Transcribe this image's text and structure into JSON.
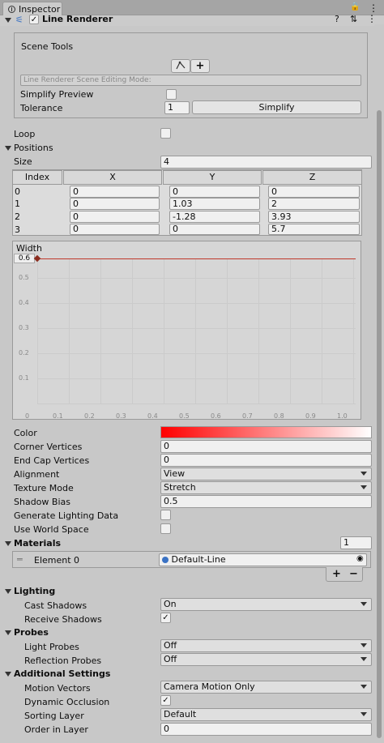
{
  "window": {
    "tab_title": "Inspector"
  },
  "component": {
    "title": "Line Renderer",
    "enabled_check": "✓"
  },
  "scene_tools": {
    "title": "Scene Tools",
    "edit_icon": "curve-edit-icon",
    "add_icon": "+",
    "mode_placeholder": "Line Renderer Scene Editing Mode:",
    "simplify_preview_label": "Simplify Preview",
    "tolerance_label": "Tolerance",
    "tolerance_value": "1",
    "simplify_button": "Simplify"
  },
  "loop": {
    "label": "Loop"
  },
  "positions": {
    "label": "Positions",
    "size_label": "Size",
    "size_value": "4",
    "headers": [
      "Index",
      "X",
      "Y",
      "Z"
    ],
    "rows": [
      [
        "0",
        "0",
        "0",
        "0"
      ],
      [
        "1",
        "0",
        "1.03",
        "2"
      ],
      [
        "2",
        "0",
        "-1.28",
        "3.93"
      ],
      [
        "3",
        "0",
        "0",
        "5.7"
      ]
    ]
  },
  "width_curve": {
    "title": "Width",
    "value_label": "0.6",
    "y_ticks": [
      "0.5",
      "0.4",
      "0.3",
      "0.2",
      "0.1",
      "0"
    ],
    "x_ticks": [
      "0.1",
      "0.2",
      "0.3",
      "0.4",
      "0.5",
      "0.6",
      "0.7",
      "0.8",
      "0.9",
      "1.0"
    ]
  },
  "properties": {
    "color_label": "Color",
    "corner_vertices_label": "Corner Vertices",
    "corner_vertices_value": "0",
    "end_cap_label": "End Cap Vertices",
    "end_cap_value": "0",
    "alignment_label": "Alignment",
    "alignment_value": "View",
    "texture_mode_label": "Texture Mode",
    "texture_mode_value": "Stretch",
    "shadow_bias_label": "Shadow Bias",
    "shadow_bias_value": "0.5",
    "gen_lighting_label": "Generate Lighting Data",
    "world_space_label": "Use World Space"
  },
  "materials": {
    "label": "Materials",
    "count": "1",
    "element_label": "Element 0",
    "element_value": "Default-Line",
    "add": "+",
    "remove": "−"
  },
  "lighting": {
    "label": "Lighting",
    "cast_shadows_label": "Cast Shadows",
    "cast_shadows_value": "On",
    "receive_shadows_label": "Receive Shadows",
    "receive_check": "✓"
  },
  "probes": {
    "label": "Probes",
    "light_probes_label": "Light Probes",
    "light_probes_value": "Off",
    "reflection_label": "Reflection Probes",
    "reflection_value": "Off"
  },
  "additional": {
    "label": "Additional Settings",
    "motion_label": "Motion Vectors",
    "motion_value": "Camera Motion Only",
    "occlusion_label": "Dynamic Occlusion",
    "occlusion_check": "✓",
    "sorting_label": "Sorting Layer",
    "sorting_value": "Default",
    "order_label": "Order in Layer",
    "order_value": "0"
  },
  "colors": {
    "gradient_start": "#ff0000",
    "gradient_end": "#ffffff",
    "curve": "#c0392b",
    "accent": "#3a72c4"
  }
}
